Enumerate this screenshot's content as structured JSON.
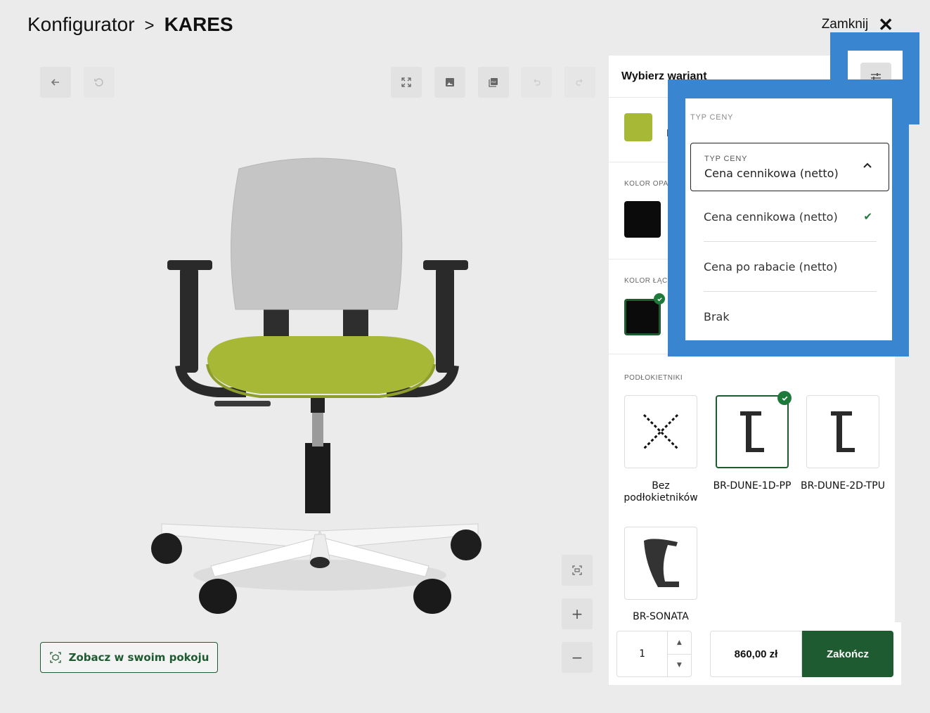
{
  "header": {
    "breadcrumb_root": "Konfigurator",
    "breadcrumb_sep": ">",
    "breadcrumb_current": "KARES",
    "close_label": "Zamknij",
    "close_icon": "✕"
  },
  "viewer": {
    "ar_button_label": "Zobacz w swoim pokoju"
  },
  "panel": {
    "title": "Wybierz wariant",
    "sections": {
      "color_back_label": "KOLOR OPA",
      "color_joint_label": "KOLOR ŁĄC",
      "armrests_label": "PODŁOKIETNIKI"
    },
    "top_swatch_partial": "L",
    "armrests": [
      {
        "label": "Bez podłokietników",
        "selected": false
      },
      {
        "label": "BR-DUNE-1D-PP",
        "selected": true
      },
      {
        "label": "BR-DUNE-2D-TPU",
        "selected": false
      },
      {
        "label": "BR-SONATA",
        "selected": false
      }
    ]
  },
  "bottom_bar": {
    "quantity": "1",
    "price": "860,00 zł",
    "finish_label": "Zakończ"
  },
  "price_type_dropdown": {
    "section_label": "TYP CENY",
    "field_label": "TYP CENY",
    "selected_value": "Cena cennikowa (netto)",
    "options": [
      {
        "label": "Cena cennikowa (netto)",
        "checked": true
      },
      {
        "label": "Cena po rabacie (netto)",
        "checked": false
      },
      {
        "label": "Brak",
        "checked": false
      }
    ]
  },
  "colors": {
    "accent_green": "#1e5b31",
    "seat_green": "#a6b836",
    "highlight_blue": "#3a85d0"
  }
}
